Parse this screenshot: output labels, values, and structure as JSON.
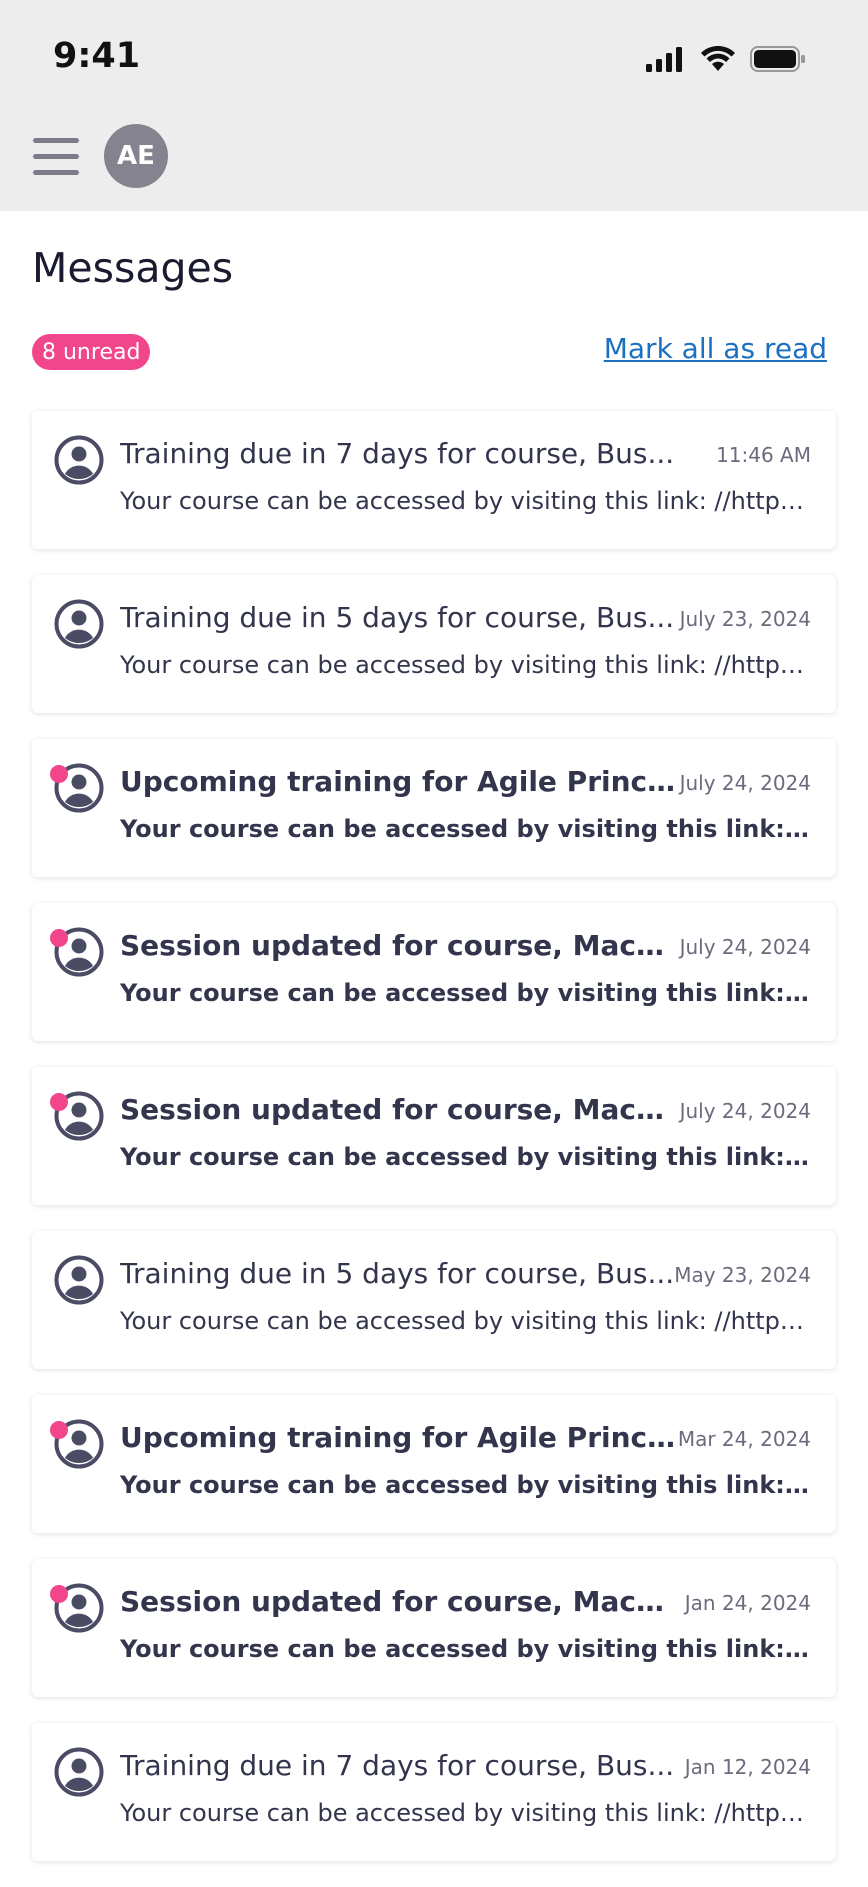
{
  "status_bar": {
    "time": "9:41"
  },
  "header": {
    "avatar_initials": "AE"
  },
  "page": {
    "title": "Messages",
    "unread_badge": "8 unread",
    "mark_all_label": "Mark all as read"
  },
  "colors": {
    "accent_pink": "#f2468c",
    "link_blue": "#1d6fc2"
  },
  "messages": [
    {
      "subject": "Training due in 7 days for course, Bus...",
      "date": "11:46 AM",
      "preview": "Your course can be accessed by visiting this link: //https:w...",
      "unread": false
    },
    {
      "subject": "Training due in 5 days for course, Bus...",
      "date": "July 23, 2024",
      "preview": "Your course can be accessed by visiting this link: //https:w...",
      "unread": false
    },
    {
      "subject": "Upcoming training for Agile Principl...",
      "date": "July 24, 2024",
      "preview": "Your course can be accessed by visiting this link: //https...",
      "unread": true
    },
    {
      "subject": "Session updated for course, Machin...",
      "date": "July 24, 2024",
      "preview": "Your course can be accessed by visiting this link: //https...",
      "unread": true
    },
    {
      "subject": "Session updated for course, Machin...",
      "date": "July 24, 2024",
      "preview": "Your course can be accessed by visiting this link: //https...",
      "unread": true
    },
    {
      "subject": "Training due in 5 days for course, Bus...",
      "date": "May 23, 2024",
      "preview": "Your course can be accessed by visiting this link: //https:w...",
      "unread": false
    },
    {
      "subject": "Upcoming training for Agile Principl...",
      "date": "Mar 24, 2024",
      "preview": "Your course can be accessed by visiting this link: //https...",
      "unread": true
    },
    {
      "subject": "Session updated for course, Machin...",
      "date": "Jan 24, 2024",
      "preview": "Your course can be accessed by visiting this link: //https...",
      "unread": true
    },
    {
      "subject": "Training due in 7 days for course, Bus...",
      "date": "Jan 12, 2024",
      "preview": "Your course can be accessed by visiting this link: //https:w...",
      "unread": false
    }
  ]
}
